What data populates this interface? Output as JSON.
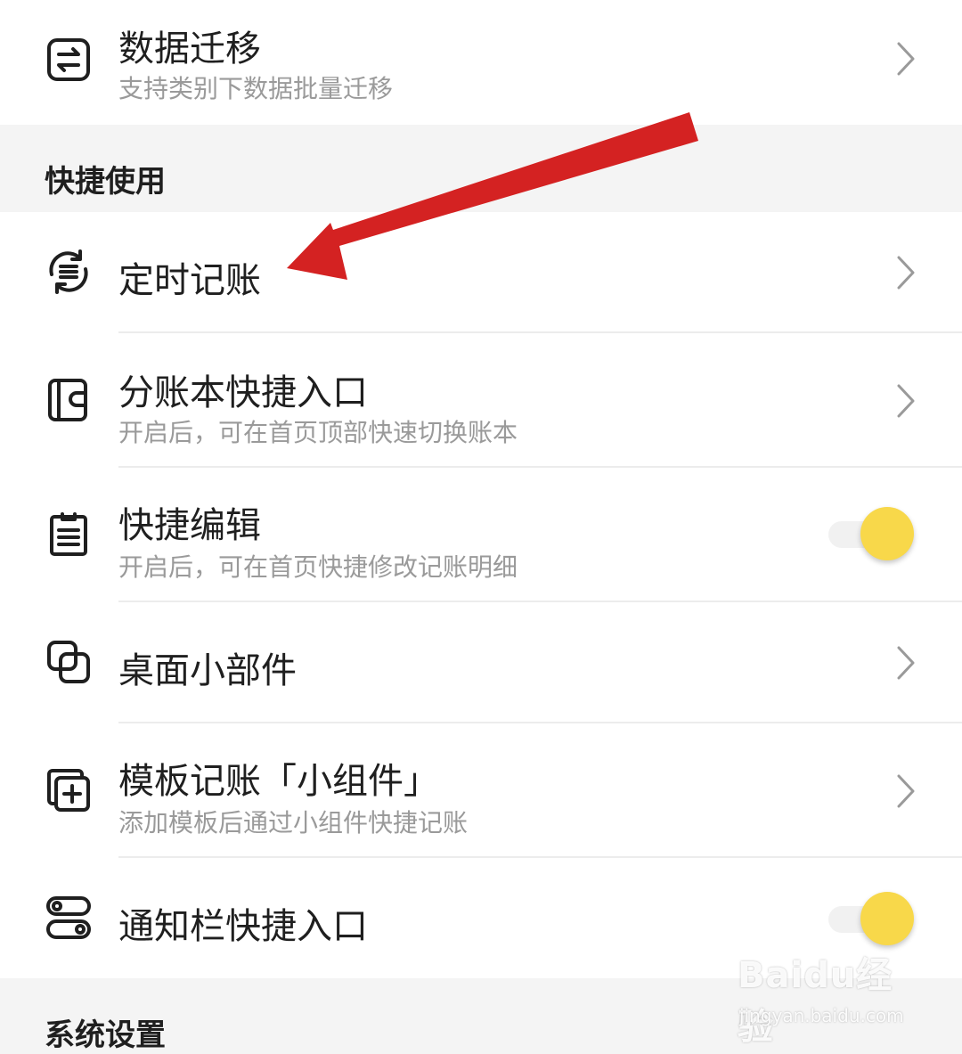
{
  "top_row": {
    "title": "数据迁移",
    "subtitle": "支持类别下数据批量迁移",
    "icon": "transfer-icon"
  },
  "section_quick": {
    "title": "快捷使用"
  },
  "quick_items": [
    {
      "title": "定时记账",
      "subtitle": "",
      "icon": "scheduled-refresh-icon",
      "control": "chevron"
    },
    {
      "title": "分账本快捷入口",
      "subtitle": "开启后，可在首页顶部快速切换账本",
      "icon": "ledger-book-icon",
      "control": "chevron"
    },
    {
      "title": "快捷编辑",
      "subtitle": "开启后，可在首页快捷修改记账明细",
      "icon": "clipboard-icon",
      "control": "toggle",
      "toggle_on": true
    },
    {
      "title": "桌面小部件",
      "subtitle": "",
      "icon": "widget-overlap-icon",
      "control": "chevron"
    },
    {
      "title": "模板记账「小组件」",
      "subtitle": "添加模板后通过小组件快捷记账",
      "icon": "add-template-icon",
      "control": "chevron"
    },
    {
      "title": "通知栏快捷入口",
      "subtitle": "",
      "icon": "notification-toggle-icon",
      "control": "toggle",
      "toggle_on": true
    }
  ],
  "section_system": {
    "title": "系统设置"
  },
  "watermark": {
    "brand": "Baidu经验",
    "url": "jingyan.baidu.com"
  },
  "colors": {
    "accent_toggle": "#f8d84a",
    "annotation_arrow": "#d42222",
    "section_bg": "#f4f4f4",
    "card_bg": "#ffffff",
    "subtitle_text": "#9a9a9a"
  }
}
